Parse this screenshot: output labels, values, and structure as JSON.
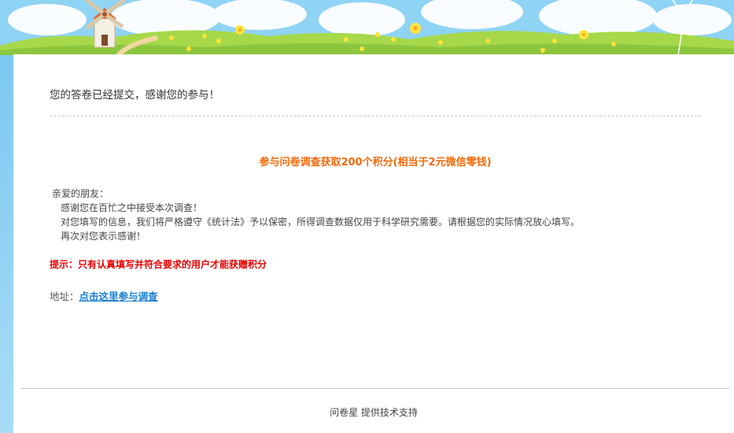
{
  "message": {
    "thanks": "您的答卷已经提交，感谢您的参与！",
    "headline": "参与问卷调查获取200个积分(相当于2元微信零钱)",
    "greeting": "亲爱的朋友：",
    "line1": "感谢您在百忙之中接受本次调查！",
    "line2": "对您填写的信息，我们将严格遵守《统计法》予以保密，所得调查数据仅用于科学研究需要。请根据您的实际情况放心填写。",
    "line3": "再次对您表示感谢！",
    "tip": "提示：只有认真填写并符合要求的用户才能获赠积分",
    "address_label": "地址：",
    "address_link": "点击这里参与调查"
  },
  "footer": {
    "text": "问卷星 提供技术支持"
  },
  "colors": {
    "headline": "#f26a0a",
    "tip": "#e60000",
    "link": "#1a7fd0",
    "sky": "#7cc8f0",
    "grass": "#8cc63f"
  }
}
